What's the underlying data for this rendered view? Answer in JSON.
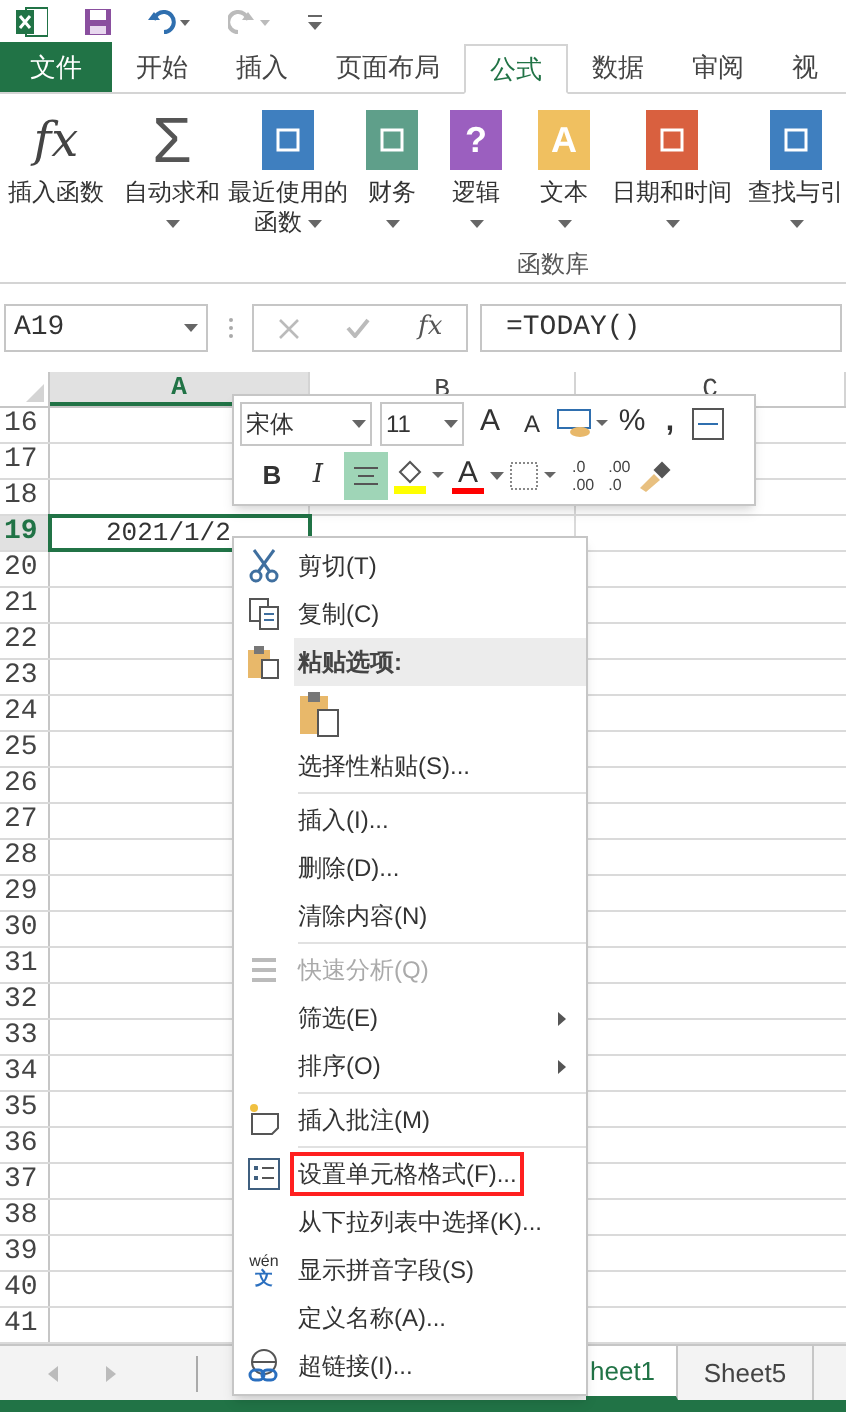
{
  "tabs": [
    {
      "label": "文件",
      "kind": "file",
      "selected": false
    },
    {
      "label": "开始",
      "kind": "tab",
      "selected": false
    },
    {
      "label": "插入",
      "kind": "tab",
      "selected": false
    },
    {
      "label": "页面布局",
      "kind": "tab",
      "selected": false
    },
    {
      "label": "公式",
      "kind": "tab",
      "selected": true
    },
    {
      "label": "数据",
      "kind": "tab",
      "selected": false
    },
    {
      "label": "审阅",
      "kind": "tab",
      "selected": false
    },
    {
      "label": "视",
      "kind": "tab",
      "selected": false
    }
  ],
  "ribbon": {
    "buttons": [
      {
        "kind": "fx",
        "glyph": "fx",
        "lines": [
          "插入函数"
        ],
        "dropdown": false
      },
      {
        "kind": "sigma",
        "glyph": "Σ",
        "lines": [
          "自动求和"
        ],
        "dropdown": true
      },
      {
        "kind": "book",
        "color": "#3f7fbf",
        "lines": [
          "最近使用的",
          "函数"
        ],
        "dropdown": true
      },
      {
        "kind": "book",
        "color": "#5f9f8a",
        "lines": [
          "财务"
        ],
        "dropdown": true
      },
      {
        "kind": "book",
        "color": "#9b5fbf",
        "glyph": "?",
        "lines": [
          "逻辑"
        ],
        "dropdown": true
      },
      {
        "kind": "book",
        "color": "#f0c060",
        "glyph": "A",
        "lines": [
          "文本"
        ],
        "dropdown": true
      },
      {
        "kind": "book",
        "color": "#d9603f",
        "lines": [
          "日期和时间"
        ],
        "dropdown": true
      },
      {
        "kind": "book",
        "color": "#3f7fbf",
        "lines": [
          "查找与引"
        ],
        "dropdown": true
      }
    ],
    "group_label": "函数库"
  },
  "formula_bar": {
    "name_box": "A19",
    "fx": "fx",
    "formula": "=TODAY()"
  },
  "columns": [
    {
      "label": "A",
      "selected": true
    },
    {
      "label": "B",
      "selected": false
    },
    {
      "label": "C",
      "selected": false
    }
  ],
  "rows": [
    {
      "label": "16",
      "selected": false
    },
    {
      "label": "17",
      "selected": false
    },
    {
      "label": "18",
      "selected": false
    },
    {
      "label": "19",
      "selected": true,
      "value": "2021/1/2"
    },
    {
      "label": "20",
      "selected": false
    },
    {
      "label": "21",
      "selected": false
    },
    {
      "label": "22",
      "selected": false
    },
    {
      "label": "23",
      "selected": false
    },
    {
      "label": "24",
      "selected": false
    },
    {
      "label": "25",
      "selected": false
    },
    {
      "label": "26",
      "selected": false
    },
    {
      "label": "27",
      "selected": false
    },
    {
      "label": "28",
      "selected": false
    },
    {
      "label": "29",
      "selected": false
    },
    {
      "label": "30",
      "selected": false
    },
    {
      "label": "31",
      "selected": false
    },
    {
      "label": "32",
      "selected": false
    },
    {
      "label": "33",
      "selected": false
    },
    {
      "label": "34",
      "selected": false
    },
    {
      "label": "35",
      "selected": false
    },
    {
      "label": "36",
      "selected": false
    },
    {
      "label": "37",
      "selected": false
    },
    {
      "label": "38",
      "selected": false
    },
    {
      "label": "39",
      "selected": false
    },
    {
      "label": "40",
      "selected": false
    },
    {
      "label": "41",
      "selected": false
    }
  ],
  "mini_toolbar": {
    "font": "宋体",
    "size": "11",
    "grow": "A",
    "shrink": "A",
    "percent": "%",
    "comma": ",",
    "bold": "B",
    "italic": "I",
    "center_selected": true,
    "font_color": "A",
    "more_decimals": [
      ".0",
      ".00"
    ],
    "fewer_decimals": [
      ".00",
      ".0"
    ]
  },
  "context_menu": [
    {
      "kind": "item",
      "label": "剪切(T)",
      "disabled": false
    },
    {
      "kind": "item",
      "label": "复制(C)",
      "disabled": false
    },
    {
      "kind": "header",
      "label": "粘贴选项:"
    },
    {
      "kind": "paste"
    },
    {
      "kind": "item",
      "label": "选择性粘贴(S)...",
      "disabled": false
    },
    {
      "kind": "item",
      "label": "插入(I)...",
      "separator_before": true,
      "disabled": false
    },
    {
      "kind": "item",
      "label": "删除(D)...",
      "disabled": false
    },
    {
      "kind": "item",
      "label": "清除内容(N)",
      "disabled": false
    },
    {
      "kind": "item",
      "label": "快速分析(Q)",
      "separator_before": true,
      "disabled": true
    },
    {
      "kind": "item",
      "label": "筛选(E)",
      "submenu": true,
      "disabled": false
    },
    {
      "kind": "item",
      "label": "排序(O)",
      "submenu": true,
      "disabled": false
    },
    {
      "kind": "item",
      "label": "插入批注(M)",
      "separator_before": true,
      "disabled": false
    },
    {
      "kind": "item",
      "label": "设置单元格格式(F)...",
      "separator_before": true,
      "outlined": true,
      "disabled": false
    },
    {
      "kind": "item",
      "label": "从下拉列表中选择(K)...",
      "disabled": false
    },
    {
      "kind": "item",
      "label": "显示拼音字段(S)",
      "icon_text": [
        "wén",
        "文"
      ],
      "disabled": false
    },
    {
      "kind": "item",
      "label": "定义名称(A)...",
      "disabled": false
    },
    {
      "kind": "item",
      "label": "超链接(I)...",
      "disabled": false
    }
  ],
  "sheet_tabs": [
    {
      "label": "heet1",
      "selected": true
    },
    {
      "label": "Sheet5",
      "selected": false
    }
  ]
}
